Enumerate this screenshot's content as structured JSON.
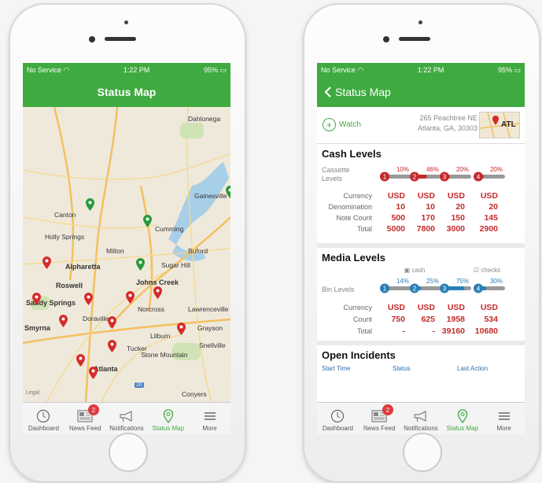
{
  "status_bar": {
    "carrier": "No Service",
    "time": "1:22 PM",
    "battery": "95%"
  },
  "map_screen": {
    "title": "Status Map",
    "places": [
      "Dahlonega",
      "Gainesville",
      "Canton",
      "Cumming",
      "Holly Springs",
      "Milton",
      "Alpharetta",
      "Sugar Hill",
      "Buford",
      "Roswell",
      "Johns Creek",
      "Sandy Springs",
      "Norcross",
      "Lawrenceville",
      "Smyrna",
      "Doraville",
      "Lilburn",
      "Grayson",
      "Tucker",
      "Snellville",
      "Stone Mountain",
      "Atlanta",
      "Conyers"
    ],
    "legal": "Legal",
    "highway": "20"
  },
  "detail_screen": {
    "back_title": "Status Map",
    "watch_label": "Watch",
    "address_line1": "265 Peachtree NE",
    "address_line2": "Atlanta, GA, 30303",
    "minimap_label": "ATL",
    "cash": {
      "heading": "Cash Levels",
      "cassette_label_1": "Cassette",
      "cassette_label_2": "Levels",
      "percents": [
        "10%",
        "46%",
        "20%",
        "20%"
      ],
      "levels": [
        0.1,
        0.46,
        0.2,
        0.2
      ],
      "indices": [
        "1",
        "2",
        "3",
        "4"
      ],
      "row_labels": [
        "Currency",
        "Denomination",
        "Note Count",
        "Total"
      ],
      "currency": [
        "USD",
        "USD",
        "USD",
        "USD"
      ],
      "denomination": [
        "10",
        "10",
        "20",
        "20"
      ],
      "note_count": [
        "500",
        "170",
        "150",
        "145"
      ],
      "total": [
        "5000",
        "7800",
        "3000",
        "2900"
      ]
    },
    "media": {
      "heading": "Media Levels",
      "cash_label": "cash",
      "checks_label": "checks",
      "bin_label": "Bin Levels",
      "percents": [
        "14%",
        "25%",
        "75%",
        "30%"
      ],
      "levels": [
        0.14,
        0.25,
        0.75,
        0.3
      ],
      "indices": [
        "1",
        "2",
        "3",
        "4"
      ],
      "row_labels": [
        "Currency",
        "Count",
        "Total"
      ],
      "currency": [
        "USD",
        "USD",
        "USD",
        "USD"
      ],
      "count": [
        "750",
        "625",
        "1958",
        "534"
      ],
      "total": [
        "-",
        "-",
        "39160",
        "10680"
      ]
    },
    "incidents": {
      "heading": "Open Incidents",
      "columns": [
        "Start Time",
        "Status",
        "Last Action"
      ]
    }
  },
  "tabs": [
    {
      "label": "Dashboard",
      "icon": "clock-icon"
    },
    {
      "label": "News Feed",
      "icon": "newspaper-icon",
      "badge": "2"
    },
    {
      "label": "Notifications",
      "icon": "megaphone-icon"
    },
    {
      "label": "Status Map",
      "icon": "map-pin-icon"
    },
    {
      "label": "More",
      "icon": "menu-icon"
    }
  ],
  "colors": {
    "green": "#3faa3f",
    "red_value": "#c42a2a",
    "blue_value": "#2a7fb5",
    "pin_red": "#d62b2b",
    "pin_green": "#2a9a3a"
  }
}
